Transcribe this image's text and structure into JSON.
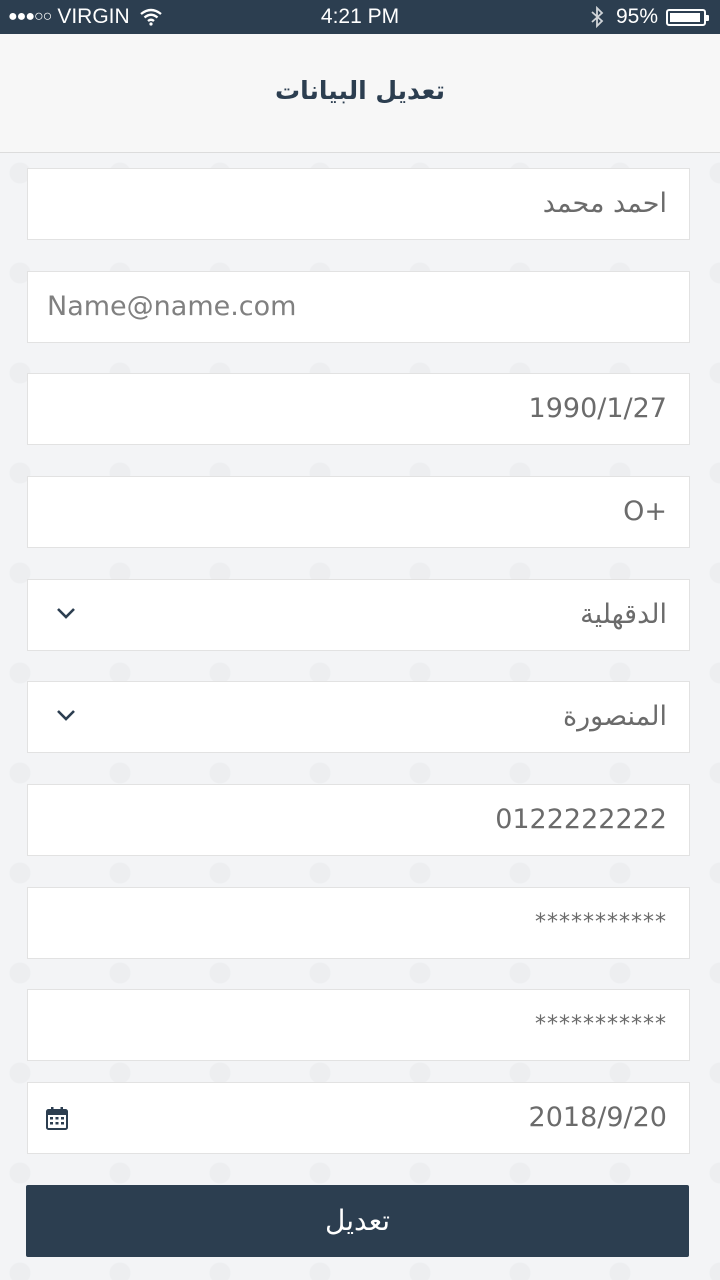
{
  "status_bar": {
    "signal": "●●●○○",
    "carrier": "VIRGIN",
    "time": "4:21 PM",
    "battery_pct": "95%",
    "battery_level": 0.95,
    "icons": [
      "wifi-icon",
      "bluetooth-icon",
      "battery-icon"
    ]
  },
  "header": {
    "title": "تعديل البيانات"
  },
  "form": {
    "name": "احمد محمد",
    "email_placeholder": "Name@name.com",
    "birth_date": "1990/1/27",
    "blood_type": "O+",
    "governorate": "الدقهلية",
    "city": "المنصورة",
    "phone": "0122222222",
    "password": "***********",
    "password_confirm": "***********",
    "date": "2018/9/20"
  },
  "submit_label": "تعديل",
  "colors": {
    "primary": "#2c3e50",
    "background": "#f3f4f6",
    "field_bg": "#ffffff",
    "text_gray": "#6b6b6b"
  }
}
